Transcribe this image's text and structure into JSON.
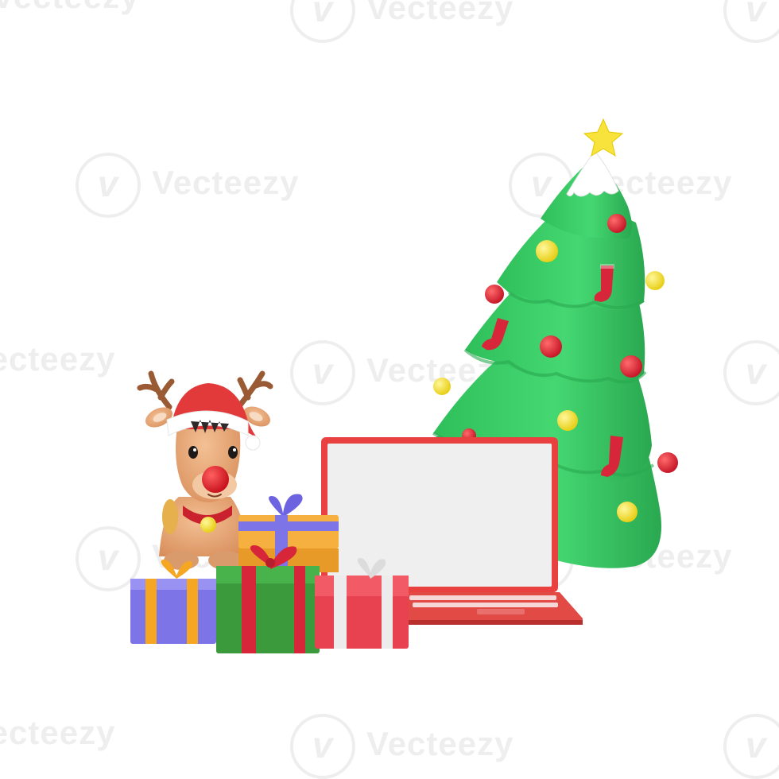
{
  "watermark": {
    "text": "Vecteezy",
    "logo_glyph": "v"
  },
  "scene": {
    "objects": [
      "reindeer",
      "christmas-tree",
      "laptop",
      "gift-boxes"
    ],
    "colors": {
      "tree": "#3fcf6a",
      "tree_shadow": "#2aa850",
      "snow": "#ffffff",
      "laptop": "#e8413f",
      "screen": "#efefef",
      "reindeer": "#e4a57a",
      "hat": "#e23a3a",
      "ornament_red": "#e3283a",
      "ornament_yellow": "#f7e33b",
      "star": "#f7e33b"
    }
  }
}
